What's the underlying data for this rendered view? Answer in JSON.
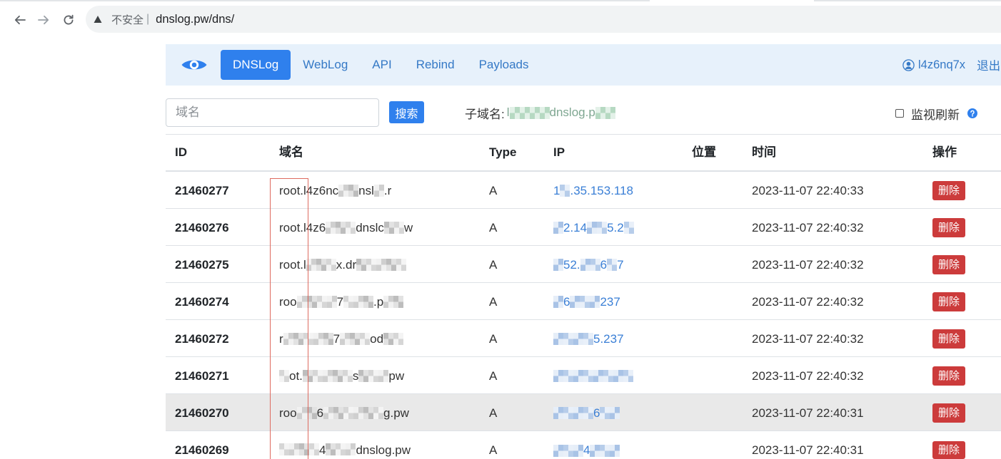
{
  "browser": {
    "back_icon": "arrow-left-icon",
    "forward_icon": "arrow-right-icon",
    "reload_icon": "reload-icon",
    "security_icon": "warning-triangle-icon",
    "security_text": "不安全",
    "separator": "|",
    "url": "dnslog.pw/dns/"
  },
  "navbar": {
    "logo_icon": "eye-icon",
    "items": [
      {
        "label": "DNSLog",
        "active": true
      },
      {
        "label": "WebLog",
        "active": false
      },
      {
        "label": "API",
        "active": false
      },
      {
        "label": "Rebind",
        "active": false
      },
      {
        "label": "Payloads",
        "active": false
      }
    ],
    "user_icon": "user-circle-icon",
    "username": "l4z6nq7x",
    "logout": "退出"
  },
  "search": {
    "placeholder": "域名",
    "value": "",
    "button": "搜索",
    "subdomain_label": "子域名:",
    "subdomain_parts": [
      "l",
      null,
      null,
      null,
      null,
      "dnslog.p",
      null,
      null
    ],
    "monitor_label": "监视刷新",
    "monitor_checked": false,
    "help_icon": "question-circle-icon"
  },
  "table": {
    "headers": [
      "ID",
      "域名",
      "Type",
      "IP",
      "位置",
      "时间",
      "操作"
    ],
    "rows": [
      {
        "id": "21460277",
        "domain": [
          "root.l4z6nc",
          null,
          null,
          "nsl",
          null,
          ".r"
        ],
        "type": "A",
        "ip": [
          "1",
          null,
          ".35.153.118"
        ],
        "time": "2023-11-07 22:40:33",
        "action": "删除",
        "highlighted": false
      },
      {
        "id": "21460276",
        "domain": [
          "root.l4z6",
          null,
          null,
          null,
          "dnslc",
          null,
          null,
          "w"
        ],
        "type": "A",
        "ip": [
          null,
          "2.14",
          null,
          null,
          "5.2",
          null
        ],
        "time": "2023-11-07 22:40:32",
        "action": "删除",
        "highlighted": false
      },
      {
        "id": "21460275",
        "domain": [
          "root.l",
          null,
          null,
          null,
          "x.dr",
          null,
          null,
          null,
          null,
          null
        ],
        "type": "A",
        "ip": [
          null,
          "52.",
          null,
          null,
          "6",
          null,
          "7"
        ],
        "time": "2023-11-07 22:40:32",
        "action": "删除",
        "highlighted": false
      },
      {
        "id": "21460274",
        "domain": [
          "roo",
          null,
          null,
          null,
          null,
          "7",
          null,
          null,
          null,
          ".p",
          null,
          null
        ],
        "type": "A",
        "ip": [
          null,
          "6",
          null,
          null,
          null,
          "237"
        ],
        "time": "2023-11-07 22:40:32",
        "action": "删除",
        "highlighted": false
      },
      {
        "id": "21460272",
        "domain": [
          "r",
          null,
          null,
          null,
          null,
          null,
          "7",
          null,
          null,
          null,
          "od",
          null,
          null
        ],
        "type": "A",
        "ip": [
          null,
          null,
          null,
          null,
          "5.237"
        ],
        "time": "2023-11-07 22:40:32",
        "action": "删除",
        "highlighted": false
      },
      {
        "id": "21460271",
        "domain": [
          null,
          "ot.",
          null,
          null,
          null,
          null,
          null,
          "s",
          null,
          null,
          null,
          "pw"
        ],
        "type": "A",
        "ip": [
          null,
          null,
          null,
          null,
          null,
          null,
          null,
          null
        ],
        "time": "2023-11-07 22:40:32",
        "action": "删除",
        "highlighted": false
      },
      {
        "id": "21460270",
        "domain": [
          "roo",
          null,
          null,
          "6",
          null,
          null,
          null,
          null,
          null,
          null,
          "g.pw"
        ],
        "type": "A",
        "ip": [
          null,
          null,
          null,
          null,
          "6",
          null,
          null
        ],
        "time": "2023-11-07 22:40:31",
        "action": "删除",
        "highlighted": true
      },
      {
        "id": "21460269",
        "domain": [
          null,
          null,
          null,
          null,
          "4",
          null,
          null,
          null,
          "dnslog.pw"
        ],
        "type": "A",
        "ip": [
          null,
          null,
          null,
          "4",
          null,
          null,
          null
        ],
        "time": "2023-11-07 22:40:31",
        "action": "删除",
        "highlighted": false
      }
    ]
  },
  "colors": {
    "accent": "#2f80ed",
    "nav_bg": "#e7f1fb",
    "link": "#3579c6",
    "ip_link": "#3a7fd6",
    "danger": "#cc3b3b",
    "row_highlight": "#e9e9e9",
    "annotation": "#de6b60",
    "omnibox_bg": "#f1f3f4"
  }
}
